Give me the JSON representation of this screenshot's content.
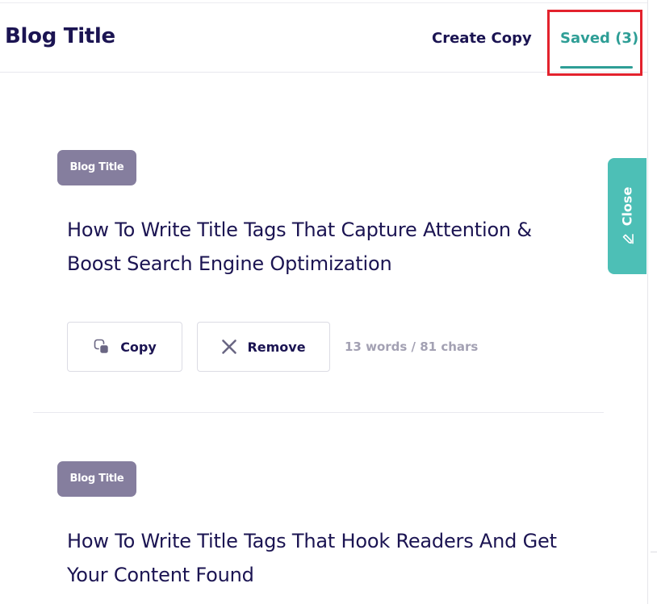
{
  "header": {
    "title": "Blog Title",
    "tabs": [
      {
        "label": "Create Copy",
        "active": false
      },
      {
        "label": "Saved (3)",
        "active": true
      }
    ]
  },
  "close_tab": {
    "label": "Close",
    "icon": "pencil-icon"
  },
  "cards": [
    {
      "badge": "Blog Title",
      "text": "How To Write Title Tags That Capture Attention & Boost Search Engine Optimization",
      "copy_label": "Copy",
      "remove_label": "Remove",
      "stats": "13 words / 81 chars"
    },
    {
      "badge": "Blog Title",
      "text": "How To Write Title Tags That Hook Readers And Get Your Content Found"
    }
  ],
  "colors": {
    "accent": "#2e9e96",
    "close_tab": "#4dbfb6",
    "badge": "#857e9e",
    "text": "#1b1452",
    "muted": "#a3a1b3",
    "highlight": "#e3222d"
  }
}
